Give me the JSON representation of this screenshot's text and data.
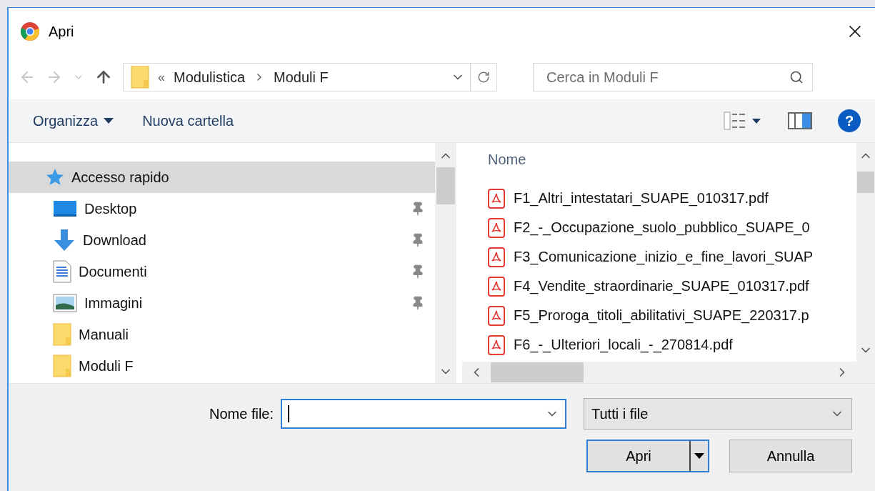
{
  "window": {
    "title": "Apri"
  },
  "nav": {
    "back_disabled": true,
    "forward_disabled": true,
    "overflow_mark": "«",
    "breadcrumb": [
      "Modulistica",
      "Moduli F"
    ]
  },
  "search": {
    "placeholder": "Cerca in Moduli F"
  },
  "toolbar": {
    "organize": "Organizza",
    "new_folder": "Nuova cartella",
    "help": "?"
  },
  "sidebar": {
    "items": [
      {
        "label": "Accesso rapido",
        "kind": "quick",
        "pinned": false,
        "selected": true
      },
      {
        "label": "Desktop",
        "kind": "desktop",
        "pinned": true,
        "selected": false
      },
      {
        "label": "Download",
        "kind": "download",
        "pinned": true,
        "selected": false
      },
      {
        "label": "Documenti",
        "kind": "documents",
        "pinned": true,
        "selected": false
      },
      {
        "label": "Immagini",
        "kind": "pictures",
        "pinned": true,
        "selected": false
      },
      {
        "label": "Manuali",
        "kind": "folder",
        "pinned": false,
        "selected": false
      },
      {
        "label": "Moduli F",
        "kind": "folder",
        "pinned": false,
        "selected": false
      }
    ]
  },
  "file_list": {
    "column": "Nome",
    "files": [
      {
        "name": "F1_Altri_intestatari_SUAPE_010317.pdf"
      },
      {
        "name": "F2_-_Occupazione_suolo_pubblico_SUAPE_0"
      },
      {
        "name": "F3_Comunicazione_inizio_e_fine_lavori_SUAP"
      },
      {
        "name": "F4_Vendite_straordinarie_SUAPE_010317.pdf"
      },
      {
        "name": "F5_Proroga_titoli_abilitativi_SUAPE_220317.p"
      },
      {
        "name": "F6_-_Ulteriori_locali_-_270814.pdf"
      }
    ]
  },
  "filename": {
    "label": "Nome file:"
  },
  "file_type": {
    "value": "Tutti i file"
  },
  "buttons": [
    {
      "label": "Apri",
      "kind": "split",
      "default": true
    },
    {
      "label": "Annulla",
      "kind": "plain",
      "default": false
    }
  ]
}
